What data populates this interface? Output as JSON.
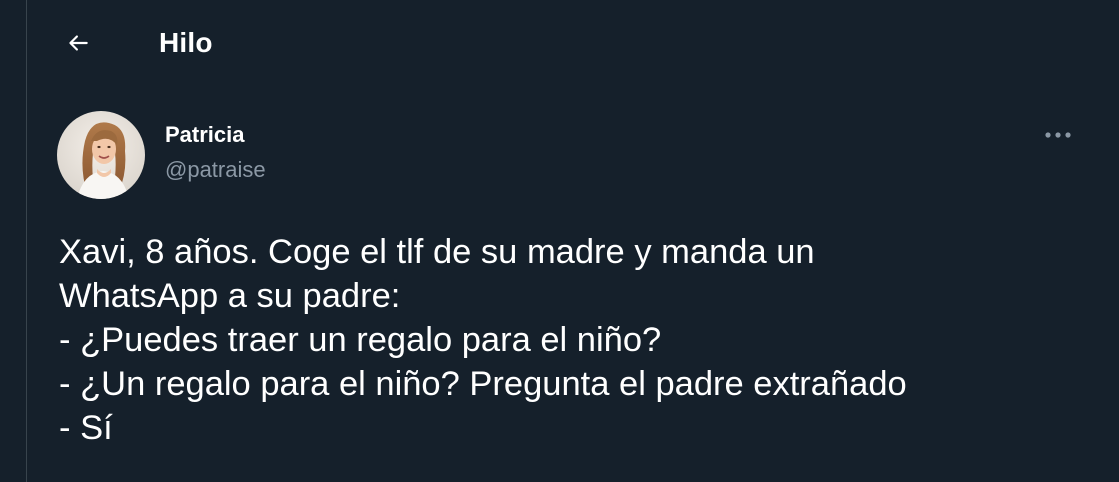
{
  "header": {
    "back_icon": "arrow-left-icon",
    "title": "Hilo"
  },
  "tweet": {
    "author": {
      "name": "Patricia",
      "handle": "@patraise",
      "avatar_icon": "profile-photo"
    },
    "more_icon": "more-horizontal-icon",
    "lines": [
      "Xavi, 8 años. Coge el tlf de su madre y manda un",
      "WhatsApp a su padre:",
      "- ¿Puedes traer un regalo para el niño?",
      "- ¿Un regalo para el niño? Pregunta el padre extrañado",
      "- Sí"
    ]
  },
  "colors": {
    "background": "#15202b",
    "border": "#38444d",
    "text_primary": "#ffffff",
    "text_secondary": "#8b98a5"
  }
}
